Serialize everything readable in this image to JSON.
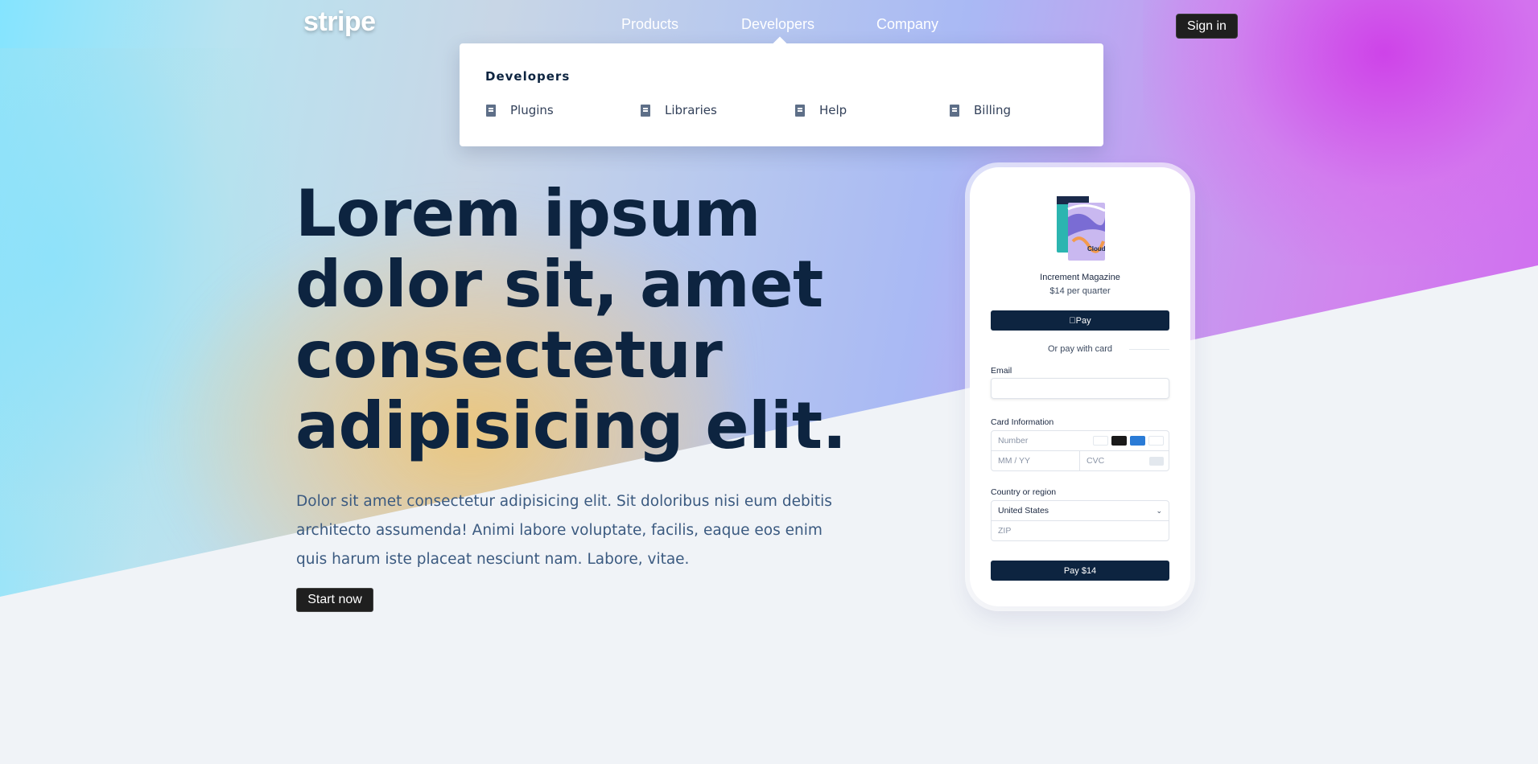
{
  "nav": {
    "logo": "stripe",
    "links": [
      "Products",
      "Developers",
      "Company"
    ],
    "signin_label": "Sign in"
  },
  "dropdown": {
    "heading": "Developers",
    "items": [
      "Plugins",
      "Libraries",
      "Help",
      "Billing"
    ]
  },
  "hero": {
    "headline": "Lorem ipsum dolor sit, amet consectetur adipisicing elit.",
    "subtext": "Dolor sit amet consectetur adipisicing elit. Sit doloribus nisi eum debitis architecto assumenda! Animi labore voluptate, facilis, eaque eos enim quis harum iste placeat nesciunt nam. Labore, vitae.",
    "cta_label": "Start now"
  },
  "checkout": {
    "product_title": "Increment Magazine",
    "product_price": "$14 per quarter",
    "applepay_label": "Pay",
    "divider_text": "Or pay with card",
    "email_label": "Email",
    "card_label": "Card Information",
    "number_placeholder": "Number",
    "expiry_placeholder": "MM / YY",
    "cvc_placeholder": "CVC",
    "country_label": "Country or region",
    "country_value": "United States",
    "zip_placeholder": "ZIP",
    "pay_label": "Pay $14",
    "product_cover_text": "Cloud"
  },
  "colors": {
    "navy": "#0d2440",
    "button_dark": "#1f1f1f",
    "body_text": "#3b5a80",
    "page_bg": "#f0f3f7"
  }
}
